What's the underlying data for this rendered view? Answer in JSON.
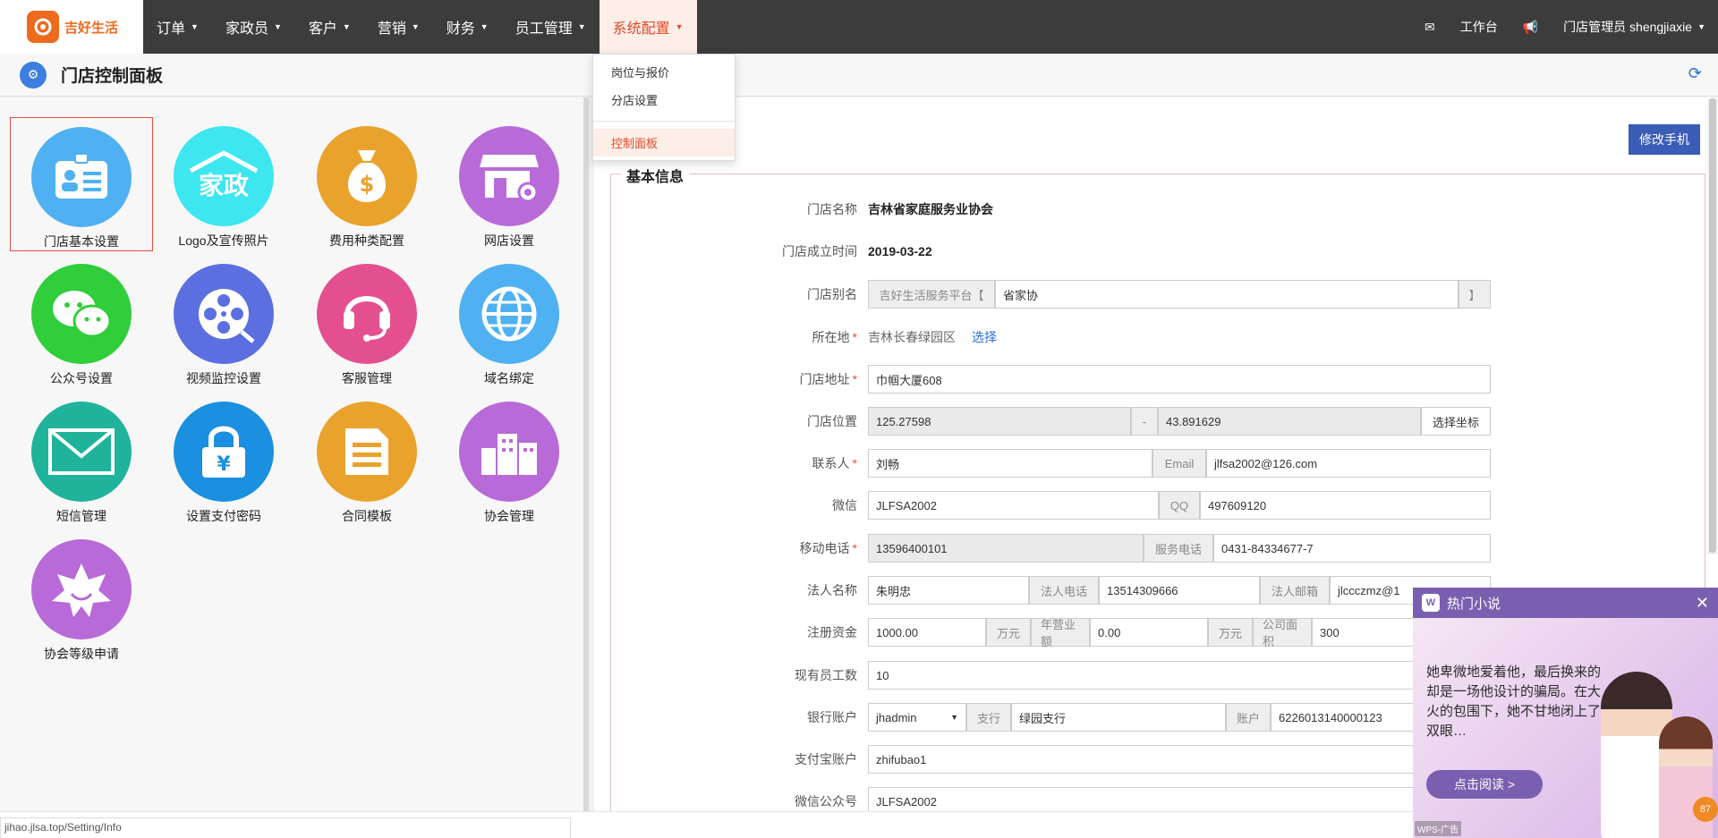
{
  "brand": {
    "name": "吉好生活",
    "mark": "⟳"
  },
  "nav": {
    "items": [
      {
        "label": "订单"
      },
      {
        "label": "家政员"
      },
      {
        "label": "客户"
      },
      {
        "label": "营销"
      },
      {
        "label": "财务"
      },
      {
        "label": "员工管理"
      },
      {
        "label": "系统配置"
      }
    ],
    "workbench": "工作台",
    "user": "门店管理员 shengjiaxie"
  },
  "dropdown": {
    "items": [
      "岗位与报价",
      "分店设置"
    ],
    "active": "控制面板"
  },
  "page": {
    "title": "门店控制面板"
  },
  "tiles": [
    {
      "label": "门店基本设置",
      "color": "#4fb1f2",
      "glyph": "▤"
    },
    {
      "label": "Logo及宣传照片",
      "color": "#3ee6f0",
      "glyph": "家政"
    },
    {
      "label": "费用种类配置",
      "color": "#e9a22c",
      "glyph": "$"
    },
    {
      "label": "网店设置",
      "color": "#b86bd8",
      "glyph": "⌂"
    },
    {
      "label": "公众号设置",
      "color": "#2fce3a",
      "glyph": "◕"
    },
    {
      "label": "视频监控设置",
      "color": "#5b6fe0",
      "glyph": "◉"
    },
    {
      "label": "客服管理",
      "color": "#e44f8f",
      "glyph": "☊"
    },
    {
      "label": "域名绑定",
      "color": "#4fb1f2",
      "glyph": "⊕"
    },
    {
      "label": "短信管理",
      "color": "#1fb39b",
      "glyph": "✉"
    },
    {
      "label": "设置支付密码",
      "color": "#1b8fe0",
      "glyph": "¥"
    },
    {
      "label": "合同模板",
      "color": "#e9a22c",
      "glyph": "▤"
    },
    {
      "label": "协会管理",
      "color": "#b86bd8",
      "glyph": "▥"
    },
    {
      "label": "协会等级申请",
      "color": "#b86bd8",
      "glyph": "✶"
    }
  ],
  "form": {
    "edit_phone": "修改手机",
    "legend": "基本信息",
    "store_name_label": "门店名称",
    "store_name": "吉林省家庭服务业协会",
    "founded_label": "门店成立时间",
    "founded": "2019-03-22",
    "alias_label": "门店别名",
    "alias_prefix": "吉好生活服务平台【",
    "alias": "省家协",
    "alias_suffix": "】",
    "location_label": "所在地",
    "location": "吉林长春绿园区",
    "location_link": "选择",
    "address_label": "门店地址",
    "address": "巾帼大厦608",
    "position_label": "门店位置",
    "lng": "125.27598",
    "dash": "-",
    "lat": "43.891629",
    "pick_coord": "选择坐标",
    "contact_label": "联系人",
    "contact": "刘畅",
    "email_label": "Email",
    "email": "jlfsa2002@126.com",
    "wechat_label": "微信",
    "wechat": "JLFSA2002",
    "qq_label": "QQ",
    "qq": "497609120",
    "mobile_label": "移动电话",
    "mobile": "13596400101",
    "service_phone_label": "服务电话",
    "service_phone": "0431-84334677-7",
    "legal_label": "法人名称",
    "legal": "朱明忠",
    "legal_phone_label": "法人电话",
    "legal_phone": "13514309666",
    "legal_email_label": "法人邮箱",
    "legal_email": "jlccczmz@1",
    "capital_label": "注册资金",
    "capital": "1000.00",
    "capital_unit": "万元",
    "revenue_label": "年营业额",
    "revenue": "0.00",
    "revenue_unit": "万元",
    "area_label": "公司面积",
    "area": "300",
    "staff_label": "现有员工数",
    "staff": "10",
    "bank_label": "银行账户",
    "bank": "jhadmin",
    "branch_label": "支行",
    "branch": "绿园支行",
    "account_label": "账户",
    "account": "6226013140000123",
    "alipay_label": "支付宝账户",
    "alipay": "zhifubao1",
    "wxmp_label": "微信公众号",
    "wxmp": "JLFSA2002"
  },
  "ad": {
    "title": "热门小说",
    "text": "她卑微地爱着他，最后换来的却是一场他设计的骗局。在大火的包围下，她不甘地闭上了双眼…",
    "button": "点击阅读 >",
    "tag": "WPS-广告",
    "badge_num": "87"
  },
  "statusbar": {
    "url": "jihao.jlsa.top/Setting/Info"
  }
}
